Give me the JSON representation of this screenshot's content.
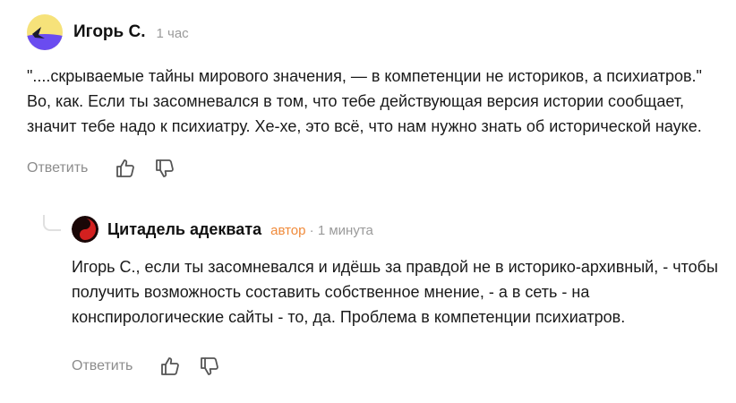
{
  "comments": [
    {
      "author": "Игорь С.",
      "time": "1 час",
      "text": "\"....скрываемые тайны мирового значения, — в компетенции не историков, а психиатров.\" Во, как. Если ты засомневался в том, что тебе действующая версия истории сообщает, значит тебе надо к психиатру. Хе-хе, это всё, что нам нужно знать об исторической науке.",
      "reply_label": "Ответить"
    },
    {
      "author": "Цитадель адеквата",
      "role": "автор",
      "separator": " · ",
      "time": "1 минута",
      "text": "Игорь С., если ты засомневался и идёшь за правдой не в историко-архивный, - чтобы получить возможность составить собственное мнение, - а в сеть - на конспирологические сайты - то, да. Проблема в компетенции психиатров.",
      "reply_label": "Ответить"
    }
  ],
  "icons": [
    "avatar-yellow-purple",
    "avatar-yin-yang",
    "thumbs-up-icon",
    "thumbs-down-icon"
  ],
  "colors": {
    "author_role": "#f08a3a",
    "meta": "#9a9a9a",
    "action": "#8c8c8c"
  }
}
